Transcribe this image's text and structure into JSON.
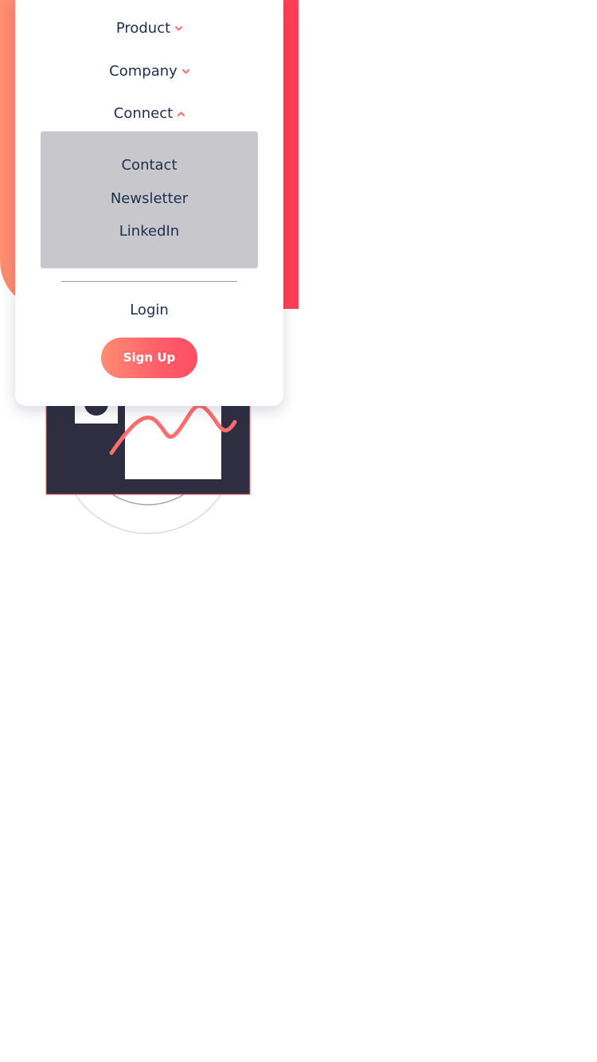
{
  "menu": {
    "items": [
      {
        "label": "Product",
        "state": "collapsed",
        "icon": "chevron-down-icon"
      },
      {
        "label": "Company",
        "state": "collapsed",
        "icon": "chevron-down-icon"
      },
      {
        "label": "Connect",
        "state": "expanded",
        "icon": "chevron-up-icon"
      }
    ],
    "connect_submenu": [
      "Contact",
      "Newsletter",
      "LinkedIn"
    ],
    "login_label": "Login",
    "signup_label": "Sign Up"
  },
  "colors": {
    "text": "#1f2d4e",
    "accent": "#ff6a6a",
    "hero_gradient_start": "#ff8f70",
    "hero_gradient_end": "#ff3d54",
    "submenu_bg": "#c8c8cc",
    "illustration_dark": "#2e2e40"
  }
}
